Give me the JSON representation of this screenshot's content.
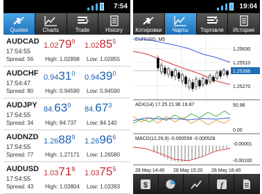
{
  "left": {
    "status": {
      "time": "7:54"
    },
    "tabs": [
      {
        "label": "Quotes",
        "icon": "quotes-icon",
        "active": true
      },
      {
        "label": "Charts",
        "icon": "charts-icon",
        "active": false
      },
      {
        "label": "Trade",
        "icon": "trade-icon",
        "active": false
      },
      {
        "label": "History",
        "icon": "history-icon",
        "active": false
      }
    ],
    "quotes": [
      {
        "symbol": "AUDCAD",
        "time": "17:54:55",
        "spread": "Spread: 56",
        "bid_pre": "1.02",
        "bid_big": "79",
        "bid_sup": "9",
        "ask_pre": "1.02",
        "ask_big": "85",
        "ask_sup": "5",
        "high": "High: 1.02898",
        "low": "Low: 1.02855",
        "color": "#c0282d"
      },
      {
        "symbol": "AUDCHF",
        "time": "17:54:47",
        "spread": "Spread: 80",
        "bid_pre": "0.94",
        "bid_big": "31",
        "bid_sup": "0",
        "ask_pre": "0.94",
        "ask_big": "39",
        "ask_sup": "0",
        "high": "High: 0.94590",
        "low": "Low: 0.94590",
        "color": "#1b61b5"
      },
      {
        "symbol": "AUDJPY",
        "time": "17:54:55",
        "spread": "Spread: 34",
        "bid_pre": "84.",
        "bid_big": "63",
        "bid_sup": "9",
        "ask_pre": "84.",
        "ask_big": "67",
        "ask_sup": "3",
        "high": "High: 84.737",
        "low": "Low: 84.140",
        "color": "#1b61b5"
      },
      {
        "symbol": "AUDNZD",
        "time": "17:54:55",
        "spread": "Spread: 77",
        "bid_pre": "1.26",
        "bid_big": "88",
        "bid_sup": "9",
        "ask_pre": "1.26",
        "ask_big": "96",
        "ask_sup": "6",
        "high": "High: 1.27171",
        "low": "Low: 1.26580",
        "color": "#1b61b5"
      },
      {
        "symbol": "AUDUSD",
        "time": "17:54:55",
        "spread": "Spread: 43",
        "bid_pre": "1.03",
        "bid_big": "71",
        "bid_sup": "8",
        "ask_pre": "1.03",
        "ask_big": "75",
        "ask_sup": "5",
        "high": "High: 1.03804",
        "low": "Low: 1.03393",
        "color": "#c0282d"
      }
    ]
  },
  "right": {
    "status": {
      "time": "19:04"
    },
    "tabs": [
      {
        "label": "Котировки",
        "icon": "quotes-icon",
        "active": true
      },
      {
        "label": "Чарты",
        "icon": "charts-icon",
        "active": false
      },
      {
        "label": "Торговля",
        "icon": "trade-icon",
        "active": false
      },
      {
        "label": "История",
        "icon": "history-icon",
        "active": false
      }
    ],
    "chart": {
      "symbol_label": "EURUSD, M5",
      "price_axis": [
        "1.25630",
        "1.25510",
        "1.25398",
        "1.25270"
      ],
      "current_price": "1.25398",
      "adx_label": "ADX(14) 17.25 21.96 19.87",
      "adx_axis": [
        "50.96",
        "0.00"
      ],
      "macd_label": "MACD(12,26,9) -0.000558 -0.000528",
      "macd_axis": [
        "-0.00001",
        "-0.00100"
      ],
      "time_labels": [
        "28 May 14:40",
        "28 May 15:20",
        "28 May 16:40"
      ]
    },
    "toolbar": [
      "dollar-icon",
      "pie-chart-icon",
      "trend-line-icon",
      "function-icon",
      "document-icon"
    ]
  },
  "colors": {
    "accent": "#1d6fb7",
    "price_down": "#c0282d",
    "price_up": "#1b61b5",
    "ma_blue": "#3a5bd6",
    "ma_red": "#d53535"
  }
}
